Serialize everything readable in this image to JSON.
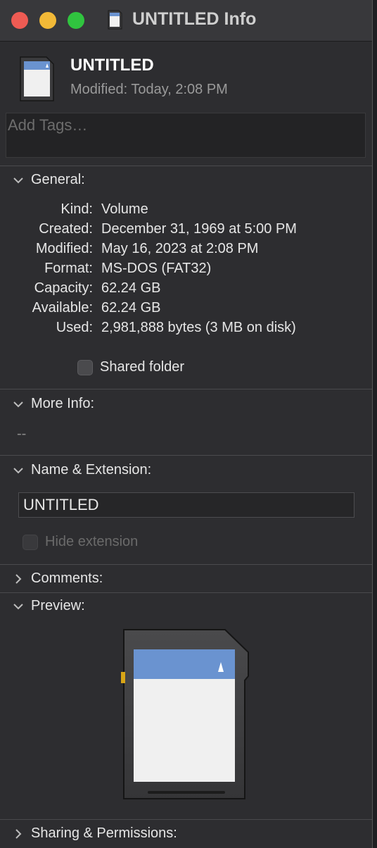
{
  "window": {
    "title": "UNTITLED Info"
  },
  "header": {
    "name": "UNTITLED",
    "modified": "Modified: Today, 2:08 PM"
  },
  "tags": {
    "placeholder": "Add Tags…"
  },
  "general": {
    "heading": "General:",
    "rows": [
      {
        "label": "Kind:",
        "value": "Volume"
      },
      {
        "label": "Created:",
        "value": "December 31, 1969 at 5:00 PM"
      },
      {
        "label": "Modified:",
        "value": "May 16, 2023 at 2:08 PM"
      },
      {
        "label": "Format:",
        "value": "MS-DOS (FAT32)"
      },
      {
        "label": "Capacity:",
        "value": "62.24 GB"
      },
      {
        "label": "Available:",
        "value": "62.24 GB"
      },
      {
        "label": "Used:",
        "value": "2,981,888 bytes (3 MB on disk)"
      }
    ],
    "shared_folder_label": "Shared folder"
  },
  "more_info": {
    "heading": "More Info:",
    "value": "--"
  },
  "name_extension": {
    "heading": "Name & Extension:",
    "name_value": "UNTITLED",
    "hide_extension_label": "Hide extension"
  },
  "comments": {
    "heading": "Comments:"
  },
  "preview": {
    "heading": "Preview:"
  },
  "sharing": {
    "heading": "Sharing & Permissions:"
  },
  "colors": {
    "close": "#ee5b53",
    "minimize": "#f2b937",
    "maximize": "#30c43f",
    "card_label_blue": "#6a93d0"
  }
}
